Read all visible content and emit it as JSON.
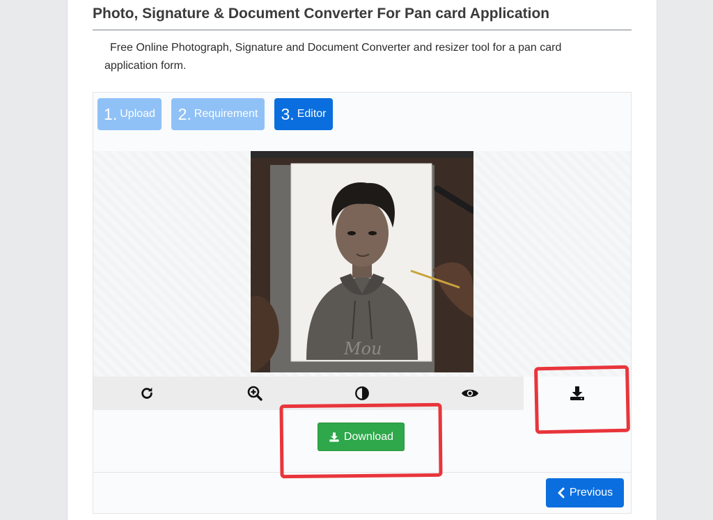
{
  "header": {
    "title": "Photo, Signature & Document Converter For Pan card Application",
    "description": "Free Online Photograph, Signature and Document Converter and resizer tool for a pan card application form."
  },
  "steps": [
    {
      "num": "1.",
      "label": "Upload",
      "state": "complete"
    },
    {
      "num": "2.",
      "label": "Requirement",
      "state": "complete"
    },
    {
      "num": "3.",
      "label": "Editor",
      "state": "active"
    }
  ],
  "toolbar": {
    "tools": [
      "rotate-icon",
      "zoom-in-icon",
      "contrast-icon",
      "eye-icon"
    ],
    "download_icon": "download-icon"
  },
  "actions": {
    "download_label": "Download",
    "previous_label": "Previous"
  },
  "photo_text": "Mou",
  "colors": {
    "step_light": "#8fc1f7",
    "step_active": "#0a6edf",
    "download_green": "#2ea84a",
    "highlight_red": "#e8353b"
  }
}
